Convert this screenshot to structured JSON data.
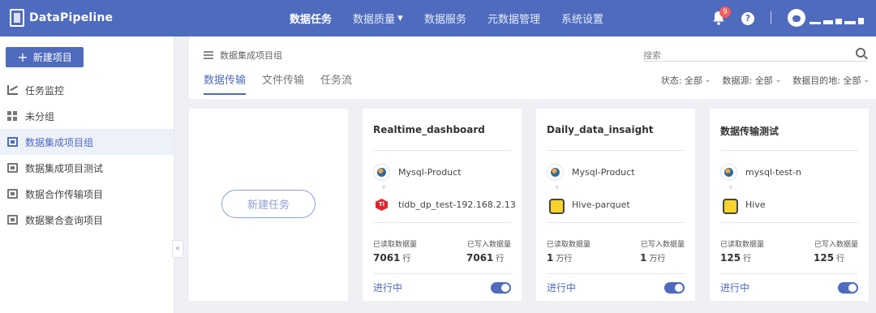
{
  "app": {
    "logo_text": "DataPipeline"
  },
  "nav": {
    "items": [
      {
        "label": "数据任务",
        "active": true,
        "dropdown": false
      },
      {
        "label": "数据质量",
        "active": false,
        "dropdown": true
      },
      {
        "label": "数据服务",
        "active": false,
        "dropdown": false
      },
      {
        "label": "元数据管理",
        "active": false,
        "dropdown": false
      },
      {
        "label": "系统设置",
        "active": false,
        "dropdown": false
      }
    ],
    "notification_count": "9",
    "help_icon": "?",
    "icons": [
      "bell-icon",
      "help-icon",
      "avatar"
    ]
  },
  "sidebar": {
    "new_project_label": "新建项目",
    "items": [
      {
        "label": "任务监控",
        "icon": "chart-icon"
      },
      {
        "label": "未分组",
        "icon": "grid-icon"
      },
      {
        "label": "数据集成项目组",
        "icon": "folder-icon",
        "active": true
      },
      {
        "label": "数据集成项目测试",
        "icon": "folder-icon"
      },
      {
        "label": "数据合作传输项目",
        "icon": "folder-icon"
      },
      {
        "label": "数据聚合查询项目",
        "icon": "folder-icon"
      }
    ],
    "collapse_glyph": "«"
  },
  "header": {
    "breadcrumb": "数据集成项目组",
    "tabs": [
      {
        "label": "数据传输",
        "active": true
      },
      {
        "label": "文件传输",
        "active": false
      },
      {
        "label": "任务流",
        "active": false
      }
    ],
    "search_placeholder": "搜索",
    "filters": [
      {
        "label": "状态:",
        "value": "全部"
      },
      {
        "label": "数据源:",
        "value": "全部"
      },
      {
        "label": "数据目的地:",
        "value": "全部"
      }
    ]
  },
  "new_task_label": "新建任务",
  "cards": [
    {
      "title": "Realtime_dashboard",
      "source": {
        "name": "Mysql-Product",
        "icon": "mysql-icon"
      },
      "destination": {
        "name": "tidb_dp_test-192.168.2.13",
        "icon": "tidb-icon"
      },
      "read_label": "已读取数据量",
      "read_value": "7061",
      "read_unit": "行",
      "write_label": "已写入数据量",
      "write_value": "7061",
      "write_unit": "行",
      "status": "进行中",
      "enabled": true
    },
    {
      "title": "Daily_data_insaight",
      "source": {
        "name": "Mysql-Product",
        "icon": "mysql-icon"
      },
      "destination": {
        "name": "Hive-parquet",
        "icon": "hive-icon"
      },
      "read_label": "已读取数据量",
      "read_value": "1",
      "read_unit": "万行",
      "write_label": "已写入数据量",
      "write_value": "1",
      "write_unit": "万行",
      "status": "进行中",
      "enabled": true
    },
    {
      "title": "数据传输测试",
      "source": {
        "name": "mysql-test-n",
        "icon": "mysql-icon"
      },
      "destination": {
        "name": "Hive",
        "icon": "hive-icon"
      },
      "read_label": "已读取数据量",
      "read_value": "125",
      "read_unit": "行",
      "write_label": "已写入数据量",
      "write_value": "125",
      "write_unit": "行",
      "status": "进行中",
      "enabled": true
    }
  ],
  "colors": {
    "brand": "#4e6bbd",
    "badge": "#f25c5c",
    "background": "#eef0f4"
  }
}
